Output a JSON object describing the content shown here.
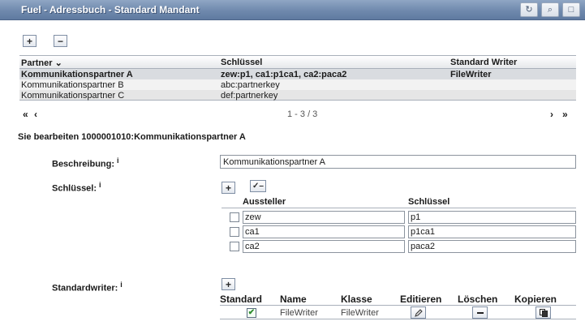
{
  "window": {
    "title": "Fuel - Adressbuch - Standard Mandant",
    "icons": [
      "refresh-icon",
      "search-icon",
      "maximize-icon"
    ]
  },
  "toolbar": {
    "add_label": "+",
    "remove_label": "−"
  },
  "partner_table": {
    "columns": [
      "Partner ⌄",
      "Schlüssel",
      "Standard Writer"
    ],
    "rows": [
      {
        "partner": "Kommunikationspartner A",
        "key": "zew:p1, ca1:p1ca1, ca2:paca2",
        "writer": "FileWriter"
      },
      {
        "partner": "Kommunikationspartner B",
        "key": "abc:partnerkey",
        "writer": ""
      },
      {
        "partner": "Kommunikationspartner C",
        "key": "def:partnerkey",
        "writer": ""
      }
    ],
    "pager": {
      "first": "«",
      "prev": "‹",
      "info": "1 - 3 / 3",
      "next": "›",
      "last": "»"
    }
  },
  "edit": {
    "title": "Sie bearbeiten 1000001010:Kommunikationspartner A",
    "beschreibung_label": "Beschreibung:",
    "beschreibung_value": "Kommunikationspartner A",
    "schluessel_label": "Schlüssel:",
    "info_glyph": "i",
    "key_add": "+",
    "key_check": "✓–",
    "key_columns": [
      "Aussteller",
      "Schlüssel"
    ],
    "keys": [
      {
        "issuer": "zew",
        "key": "p1"
      },
      {
        "issuer": "ca1",
        "key": "p1ca1"
      },
      {
        "issuer": "ca2",
        "key": "paca2"
      }
    ],
    "writer_label": "Standardwriter:",
    "writer_add": "+",
    "writer_columns": [
      "Standard",
      "Name",
      "Klasse",
      "Editieren",
      "Löschen",
      "Kopieren"
    ],
    "writer_row": {
      "standard_checked": "✔",
      "name": "FileWriter",
      "class": "FileWriter"
    }
  }
}
